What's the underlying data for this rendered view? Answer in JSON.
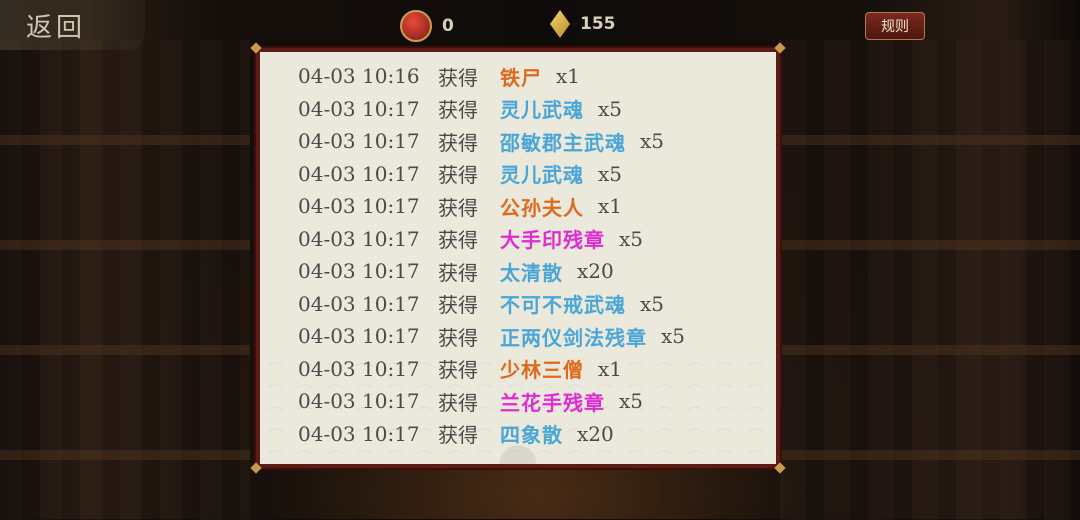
{
  "topbar": {
    "back_label": "返回",
    "rules_label": "规则",
    "resources": [
      {
        "icon": "token-icon",
        "value": "0"
      },
      {
        "icon": "gem-icon",
        "value": "155"
      }
    ]
  },
  "colors": {
    "orange": "#e06a1c",
    "blue": "#4aa6d8",
    "magenta": "#e02ad2",
    "text_gray": "#4a4a4a"
  },
  "log": [
    {
      "time": "04-03 10:16",
      "verb": "获得",
      "item": "铁尸",
      "qty": "x1",
      "color": "#e06a1c"
    },
    {
      "time": "04-03 10:17",
      "verb": "获得",
      "item": "灵儿武魂",
      "qty": "x5",
      "color": "#4aa6d8"
    },
    {
      "time": "04-03 10:17",
      "verb": "获得",
      "item": "邵敏郡主武魂",
      "qty": "x5",
      "color": "#4aa6d8"
    },
    {
      "time": "04-03 10:17",
      "verb": "获得",
      "item": "灵儿武魂",
      "qty": "x5",
      "color": "#4aa6d8"
    },
    {
      "time": "04-03 10:17",
      "verb": "获得",
      "item": "公孙夫人",
      "qty": "x1",
      "color": "#e06a1c"
    },
    {
      "time": "04-03 10:17",
      "verb": "获得",
      "item": "大手印残章",
      "qty": "x5",
      "color": "#e02ad2"
    },
    {
      "time": "04-03 10:17",
      "verb": "获得",
      "item": "太清散",
      "qty": "x20",
      "color": "#4aa6d8"
    },
    {
      "time": "04-03 10:17",
      "verb": "获得",
      "item": "不可不戒武魂",
      "qty": "x5",
      "color": "#4aa6d8"
    },
    {
      "time": "04-03 10:17",
      "verb": "获得",
      "item": "正两仪剑法残章",
      "qty": "x5",
      "color": "#4aa6d8"
    },
    {
      "time": "04-03 10:17",
      "verb": "获得",
      "item": "少林三僧",
      "qty": "x1",
      "color": "#e06a1c"
    },
    {
      "time": "04-03 10:17",
      "verb": "获得",
      "item": "兰花手残章",
      "qty": "x5",
      "color": "#e02ad2"
    },
    {
      "time": "04-03 10:17",
      "verb": "获得",
      "item": "四象散",
      "qty": "x20",
      "color": "#4aa6d8"
    }
  ]
}
